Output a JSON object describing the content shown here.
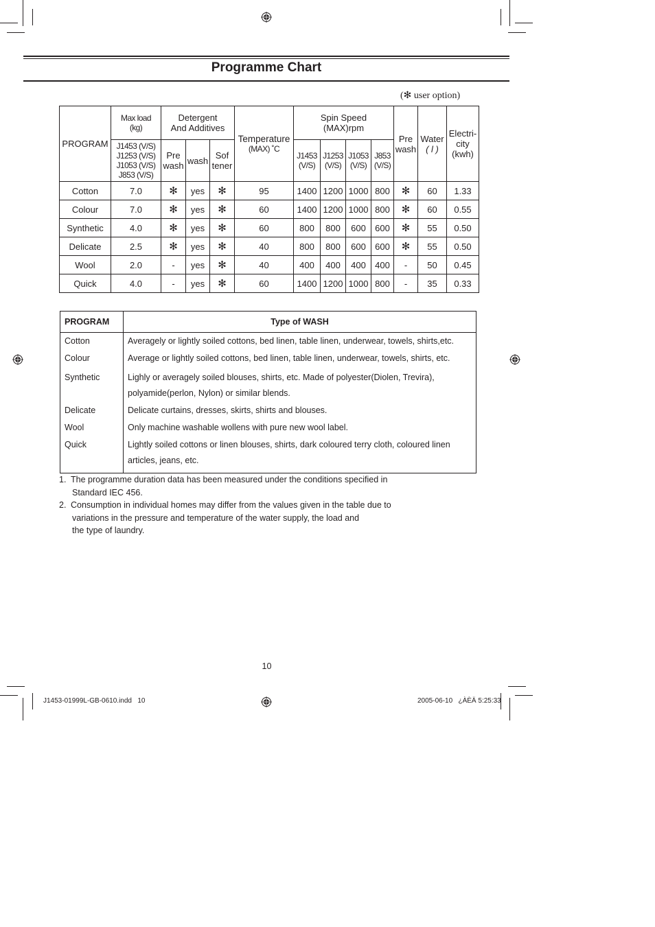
{
  "page": {
    "title": "Programme Chart",
    "user_option_note": "(✻ user option)",
    "page_number": "10",
    "slug_left": "J1453-01999L-GB-0610.indd   10",
    "slug_right": "2005-06-10   ¿ÀÈÄ 5:25:33"
  },
  "programme_table": {
    "headers": {
      "program": "PROGRAM",
      "max_load": "Max load",
      "max_load_unit": "(kg)",
      "models": [
        "J1453 (V/S)",
        "J1253 (V/S)",
        "J1053 (V/S)",
        "J853 (V/S)"
      ],
      "detergent_line1": "Detergent",
      "detergent_line2": "And Additives",
      "prewash_1": "Pre",
      "prewash_2": "wash",
      "wash": "wash",
      "softener_1": "Sof",
      "softener_2": "tener",
      "temperature": "Temperature",
      "temperature_unit": "(MAX) ˚C",
      "spin_line1": "Spin Speed",
      "spin_line2": "(MAX)rpm",
      "spin_models": [
        {
          "name": "J1453",
          "variant": "(V/S)"
        },
        {
          "name": "J1253",
          "variant": "(V/S)"
        },
        {
          "name": "J1053",
          "variant": "(V/S)"
        },
        {
          "name": "J853",
          "variant": "(V/S)"
        }
      ],
      "pre_wash_1": "Pre",
      "pre_wash_2": "wash",
      "water_1": "Water",
      "water_2": "( l )",
      "elec_1": "Electri-",
      "elec_2": "city",
      "elec_3": "(kwh)"
    },
    "rows": [
      {
        "program": "Cotton",
        "max_load": "7.0",
        "prewash": "✻",
        "wash": "yes",
        "softener": "✻",
        "temp": "95",
        "spin": [
          "1400",
          "1200",
          "1000",
          "800"
        ],
        "pre_wash": "✻",
        "water": "60",
        "electricity": "1.33"
      },
      {
        "program": "Colour",
        "max_load": "7.0",
        "prewash": "✻",
        "wash": "yes",
        "softener": "✻",
        "temp": "60",
        "spin": [
          "1400",
          "1200",
          "1000",
          "800"
        ],
        "pre_wash": "✻",
        "water": "60",
        "electricity": "0.55"
      },
      {
        "program": "Synthetic",
        "max_load": "4.0",
        "prewash": "✻",
        "wash": "yes",
        "softener": "✻",
        "temp": "60",
        "spin": [
          "800",
          "800",
          "600",
          "600"
        ],
        "pre_wash": "✻",
        "water": "55",
        "electricity": "0.50"
      },
      {
        "program": "Delicate",
        "max_load": "2.5",
        "prewash": "✻",
        "wash": "yes",
        "softener": "✻",
        "temp": "40",
        "spin": [
          "800",
          "800",
          "600",
          "600"
        ],
        "pre_wash": "✻",
        "water": "55",
        "electricity": "0.50"
      },
      {
        "program": "Wool",
        "max_load": "2.0",
        "prewash": "-",
        "wash": "yes",
        "softener": "✻",
        "temp": "40",
        "spin": [
          "400",
          "400",
          "400",
          "400"
        ],
        "pre_wash": "-",
        "water": "50",
        "electricity": "0.45"
      },
      {
        "program": "Quick",
        "max_load": "4.0",
        "prewash": "-",
        "wash": "yes",
        "softener": "✻",
        "temp": "60",
        "spin": [
          "1400",
          "1200",
          "1000",
          "800"
        ],
        "pre_wash": "-",
        "water": "35",
        "electricity": "0.33"
      }
    ]
  },
  "wash_table": {
    "headers": {
      "program": "PROGRAM",
      "type": "Type of WASH"
    },
    "rows": [
      {
        "program": "Cotton",
        "lines": [
          "Averagely or lightly soiled cottons, bed linen, table linen, underwear, towels, shirts,etc."
        ]
      },
      {
        "program": "Colour",
        "lines": [
          "Average or lightly soiled cottons, bed linen, table linen, underwear, towels, shirts, etc."
        ]
      },
      {
        "program": "Synthetic",
        "lines": [
          "Lighly or averagely soiled blouses, shirts, etc. Made of polyester(Diolen, Trevira),",
          "polyamide(perlon, Nylon) or similar blends."
        ]
      },
      {
        "program": "Delicate",
        "lines": [
          "Delicate curtains, dresses, skirts, shirts and blouses."
        ]
      },
      {
        "program": "Wool",
        "lines": [
          "Only machine washable wollens with pure new wool label."
        ]
      },
      {
        "program": "Quick",
        "lines": [
          "Lightly soiled cottons or linen blouses, shirts, dark coloured terry cloth, coloured linen",
          "articles, jeans, etc."
        ]
      }
    ]
  },
  "notes": [
    {
      "num": "1.",
      "lines": [
        "The programme duration data has been measured under the conditions specified in",
        "Standard IEC 456."
      ]
    },
    {
      "num": "2.",
      "lines": [
        "Consumption in individual homes may differ from the values given in the table due to",
        "variations in the pressure and temperature of the water supply, the load and",
        "the type of laundry."
      ]
    }
  ]
}
